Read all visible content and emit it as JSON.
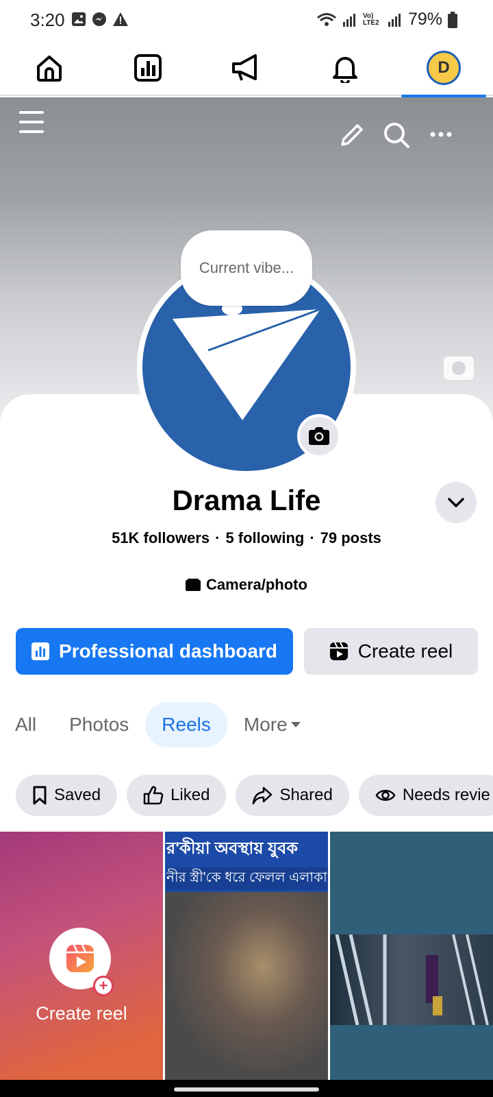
{
  "status_bar": {
    "time": "3:20",
    "battery": "79%",
    "network_label": "Vo) LTE2"
  },
  "nav": {
    "avatar_letter": "D"
  },
  "bubble": {
    "text": "Current vibe..."
  },
  "profile": {
    "name": "Drama Life",
    "followers": "51K followers",
    "following": "5 following",
    "posts": "79 posts",
    "separator": "·",
    "category": "Camera/photo"
  },
  "buttons": {
    "dashboard": "Professional dashboard",
    "create_reel": "Create reel"
  },
  "tabs": [
    {
      "label": "All"
    },
    {
      "label": "Photos"
    },
    {
      "label": "Reels"
    },
    {
      "label": "More"
    }
  ],
  "chips": [
    {
      "label": "Saved",
      "icon": "bookmark-icon"
    },
    {
      "label": "Liked",
      "icon": "thumbs-up-icon"
    },
    {
      "label": "Shared",
      "icon": "share-icon"
    },
    {
      "label": "Needs revie",
      "icon": "eye-icon"
    }
  ],
  "grid": {
    "create_label": "Create reel",
    "news_line1": "র'কীয়া অবস্থায় যুবক",
    "news_line2": "নীর স্ত্রী'কে ধরে ফেলল এলাকা"
  },
  "colors": {
    "accent": "#1877f2",
    "profile_bg": "#2962ab"
  }
}
